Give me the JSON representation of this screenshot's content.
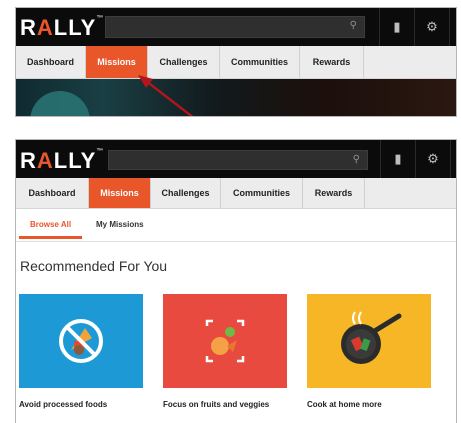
{
  "app": {
    "logo": {
      "text_main": "R",
      "text_accent": "A",
      "text_rest": "LLY",
      "trademark": "™"
    }
  },
  "toolbar": {
    "search_icon": "search-icon",
    "chat_icon": "chat-icon",
    "settings_icon": "gear-icon"
  },
  "nav": {
    "items": [
      {
        "label": "Dashboard"
      },
      {
        "label": "Missions",
        "active": true
      },
      {
        "label": "Challenges"
      },
      {
        "label": "Communities"
      },
      {
        "label": "Rewards"
      }
    ]
  },
  "subtabs": {
    "items": [
      {
        "label": "Browse All",
        "active": true
      },
      {
        "label": "My Missions",
        "active": false
      }
    ]
  },
  "main": {
    "heading": "Recommended For You",
    "cards": [
      {
        "title": "Avoid processed foods",
        "color": "#1d9ad6",
        "icon": "no-junk-food-icon"
      },
      {
        "title": "Focus on fruits and veggies",
        "color": "#e94a3f",
        "icon": "fruits-veggies-icon"
      },
      {
        "title": "Cook at home more",
        "color": "#f6b626",
        "icon": "frying-pan-icon"
      }
    ]
  },
  "colors": {
    "accent": "#e8562a",
    "topbar": "#0b0b0b",
    "nav": "#ececec",
    "annotation_arrow": "#b0161c"
  }
}
